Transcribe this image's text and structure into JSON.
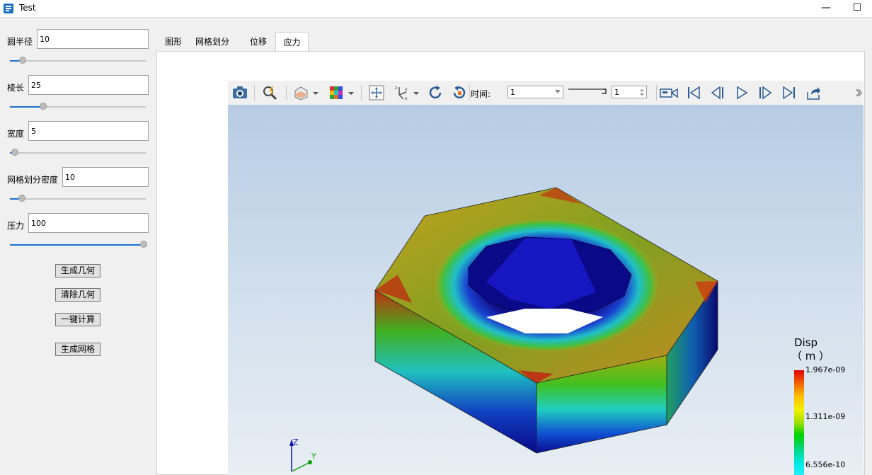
{
  "window": {
    "title": "Test",
    "minimize_symbol": "—",
    "maximize_symbol": "☐"
  },
  "params": [
    {
      "label": "圆半径",
      "value": "10",
      "slider": 0.08
    },
    {
      "label": "棱长",
      "value": "25",
      "slider": 0.25
    },
    {
      "label": "宽度",
      "value": "5",
      "slider": 0.03
    },
    {
      "label": "网格划分密度",
      "value": "10",
      "slider": 0.09
    },
    {
      "label": "压力",
      "value": "100",
      "slider": 1.0
    }
  ],
  "buttons": [
    "生成几何",
    "清除几何",
    "一键计算",
    "生成网格"
  ],
  "tabs": [
    "图形",
    "网格划分",
    "位移",
    "应力"
  ],
  "active_tab": 3,
  "toolbar": {
    "time_label": "时间:",
    "time_select": "1",
    "time_spin": "1"
  },
  "legend": {
    "title": "Disp",
    "unit": "（ m ）",
    "max": "1.967e-09",
    "mid": "1.311e-09",
    "min": "6.556e-10"
  },
  "axes": {
    "z": "Z",
    "y": "Y"
  },
  "colors": {
    "accent": "#1a72d0",
    "bg": "#f0f0f0"
  }
}
